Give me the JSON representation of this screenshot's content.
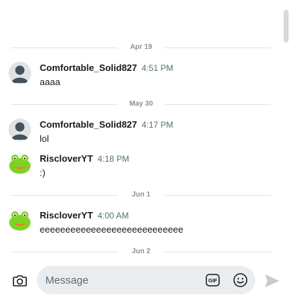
{
  "chat": {
    "dividers": [
      {
        "label": "Apr 19"
      },
      {
        "label": "May 30"
      },
      {
        "label": "Jun 1"
      },
      {
        "label": "Jun 2"
      }
    ],
    "messages": [
      {
        "username": "Comfortable_Solid827",
        "time": "4:51 PM",
        "text": "aaaa",
        "avatar": "default-user-avatar"
      },
      {
        "username": "Comfortable_Solid827",
        "time": "4:17 PM",
        "text": "lol",
        "avatar": "default-user-avatar"
      },
      {
        "username": "RiscloverYT",
        "time": "4:18 PM",
        "text": ":)",
        "avatar": "frog-avatar"
      },
      {
        "username": "RiscloverYT",
        "time": "4:00 AM",
        "text": "eeeeeeeeeeeeeeeeeeeeeeeeeeee",
        "avatar": "frog-avatar"
      }
    ]
  },
  "composer": {
    "placeholder": "Message",
    "camera_icon": "camera-icon",
    "gif_icon": "gif-icon",
    "gif_label": "GIF",
    "emoji_icon": "emoji-icon",
    "send_icon": "send-icon"
  },
  "colors": {
    "divider_text": "#8e9297",
    "timestamp": "#576f76",
    "input_bg": "#eaedef",
    "default_avatar_bg": "#dfe3e6",
    "default_avatar_fg": "#44525a",
    "frog_green": "#7ed321",
    "frog_mouth": "#ff6f3c"
  }
}
